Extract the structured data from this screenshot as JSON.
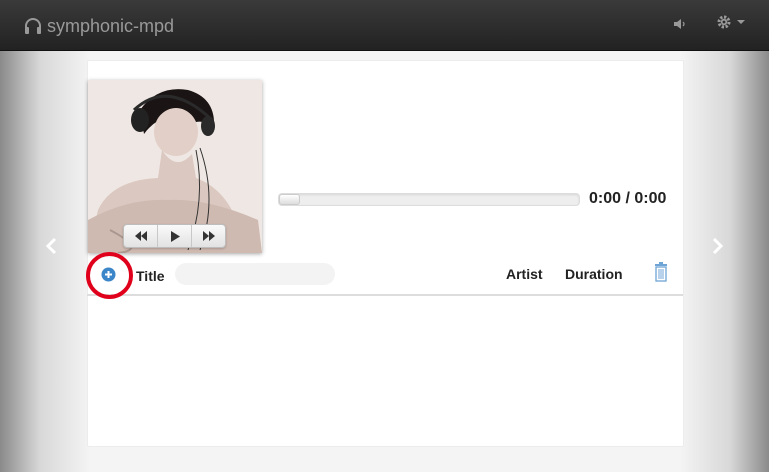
{
  "app": {
    "title": "symphonic-mpd"
  },
  "navbar": {
    "volume_icon": "volume-icon",
    "settings_icon": "gear-icon"
  },
  "player": {
    "time": "0:00 / 0:00",
    "progress": 0.07
  },
  "playlist": {
    "columns": {
      "title": "Title",
      "artist": "Artist",
      "duration": "Duration"
    },
    "filter_value": "",
    "filter_placeholder": ""
  },
  "colors": {
    "accent": "#3a86c8",
    "highlight": "#e0001b"
  }
}
